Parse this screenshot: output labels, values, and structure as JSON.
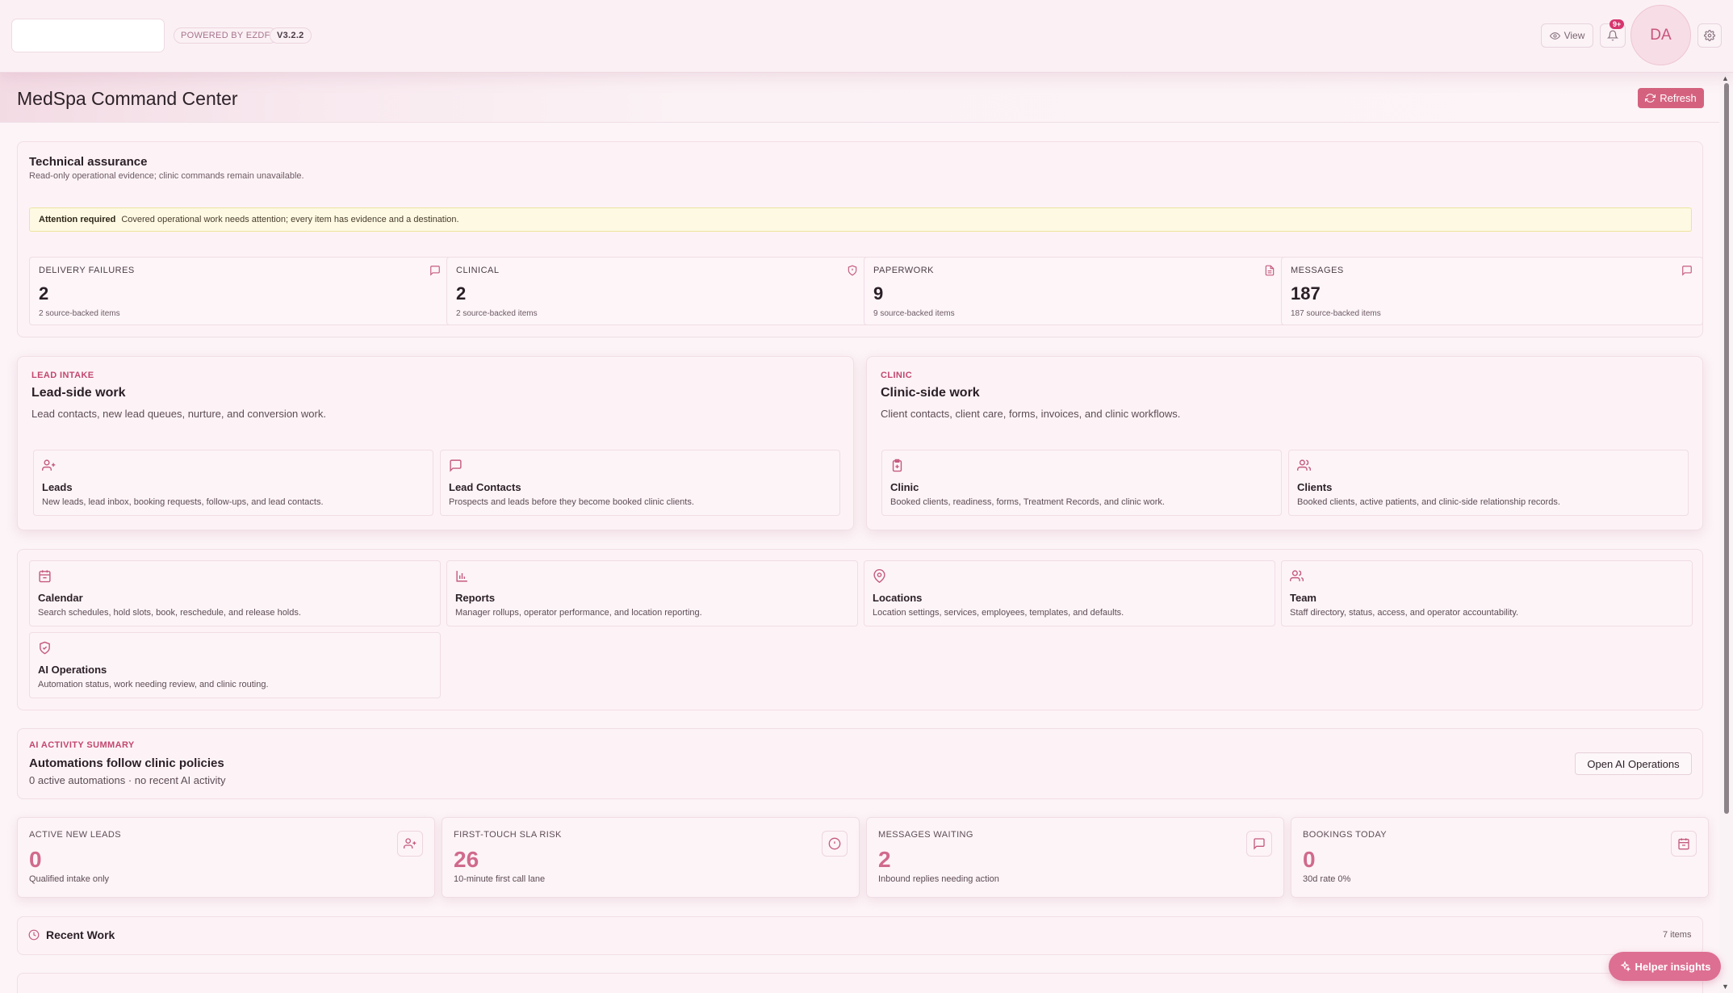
{
  "header": {
    "powered": "POWERED BY EZDF",
    "version": "V3.2.2",
    "view_label": "View",
    "notif_badge": "9+",
    "avatar_initials": "DA"
  },
  "page": {
    "title": "MedSpa Command Center",
    "refresh_label": "Refresh"
  },
  "assurance": {
    "title": "Technical assurance",
    "subtitle": "Read-only operational evidence; clinic commands remain unavailable.",
    "attention_label": "Attention required",
    "attention_text": "Covered operational work needs attention; every item has evidence and a destination.",
    "stats": [
      {
        "label": "DELIVERY FAILURES",
        "value": "2",
        "caption": "2 source-backed items",
        "icon": "message-icon"
      },
      {
        "label": "CLINICAL",
        "value": "2",
        "caption": "2 source-backed items",
        "icon": "shield-icon"
      },
      {
        "label": "PAPERWORK",
        "value": "9",
        "caption": "9 source-backed items",
        "icon": "document-icon"
      },
      {
        "label": "MESSAGES",
        "value": "187",
        "caption": "187 source-backed items",
        "icon": "message-icon"
      }
    ]
  },
  "lead_intake": {
    "kicker": "LEAD INTAKE",
    "title": "Lead-side work",
    "desc": "Lead contacts, new lead queues, nurture, and conversion work.",
    "tiles": [
      {
        "title": "Leads",
        "desc": "New leads, lead inbox, booking requests, follow-ups, and lead contacts.",
        "icon": "user-plus-icon"
      },
      {
        "title": "Lead Contacts",
        "desc": "Prospects and leads before they become booked clinic clients.",
        "icon": "message-icon"
      }
    ]
  },
  "clinic": {
    "kicker": "CLINIC",
    "title": "Clinic-side work",
    "desc": "Client contacts, client care, forms, invoices, and clinic workflows.",
    "tiles": [
      {
        "title": "Clinic",
        "desc": "Booked clients, readiness, forms, Treatment Records, and clinic work.",
        "icon": "clipboard-icon"
      },
      {
        "title": "Clients",
        "desc": "Booked clients, active patients, and clinic-side relationship records.",
        "icon": "users-icon"
      }
    ]
  },
  "modules": [
    {
      "title": "Calendar",
      "desc": "Search schedules, hold slots, book, reschedule, and release holds.",
      "icon": "calendar-icon"
    },
    {
      "title": "Reports",
      "desc": "Manager rollups, operator performance, and location reporting.",
      "icon": "bar-chart-icon"
    },
    {
      "title": "Locations",
      "desc": "Location settings, services, employees, templates, and defaults.",
      "icon": "map-pin-icon"
    },
    {
      "title": "Team",
      "desc": "Staff directory, status, access, and operator accountability.",
      "icon": "users-icon"
    },
    {
      "title": "AI Operations",
      "desc": "Automation status, work needing review, and clinic routing.",
      "icon": "shield-check-icon"
    }
  ],
  "ai_summary": {
    "kicker": "AI ACTIVITY SUMMARY",
    "title": "Automations follow clinic policies",
    "desc": "0 active automations · no recent AI activity",
    "button": "Open AI Operations"
  },
  "kpis": [
    {
      "label": "ACTIVE NEW LEADS",
      "value": "0",
      "caption": "Qualified intake only",
      "icon": "user-plus-icon"
    },
    {
      "label": "FIRST-TOUCH SLA RISK",
      "value": "26",
      "caption": "10-minute first call lane",
      "icon": "alert-icon"
    },
    {
      "label": "MESSAGES WAITING",
      "value": "2",
      "caption": "Inbound replies needing action",
      "icon": "message-icon"
    },
    {
      "label": "BOOKINGS TODAY",
      "value": "0",
      "caption": "30d rate 0%",
      "icon": "calendar-icon"
    }
  ],
  "recent_work": {
    "title": "Recent Work",
    "count": "7 items"
  },
  "helper": {
    "label": "Helper insights"
  },
  "colors": {
    "accent": "#d4627f",
    "kicker": "#c2476f",
    "kpi_number": "#d06a8d",
    "background": "#fcf4f7"
  }
}
